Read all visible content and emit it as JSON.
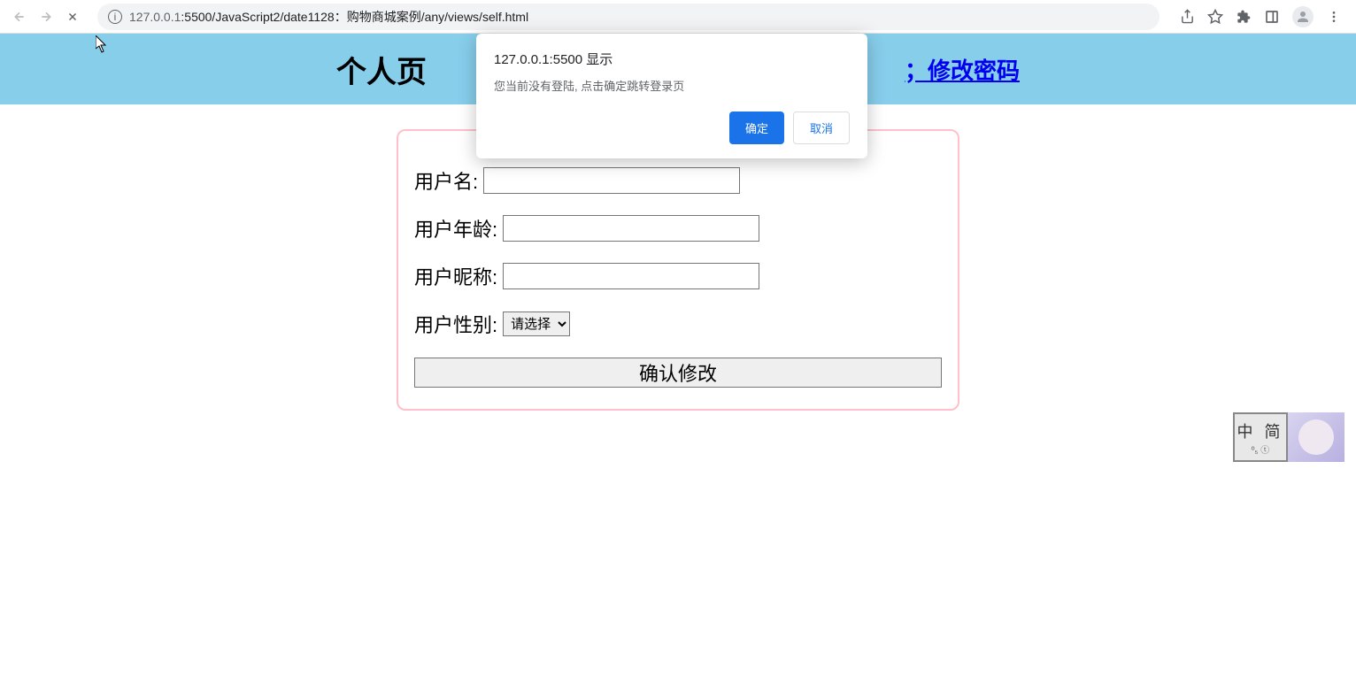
{
  "browser": {
    "url_host": "127.0.0.1",
    "url_port_path": ":5500/JavaScript2/date1128：购物商城案例/any/views/self.html"
  },
  "header": {
    "title": "个人页",
    "link_change_password": "；修改密码",
    "link_prefix": "；"
  },
  "form": {
    "username_label": "用户名:",
    "age_label": "用户年龄:",
    "nickname_label": "用户昵称:",
    "gender_label": "用户性别:",
    "gender_placeholder": "请选择",
    "submit_label": "确认修改"
  },
  "alert": {
    "title": "127.0.0.1:5500 显示",
    "message": "您当前没有登陆, 点击确定跳转登录页",
    "ok": "确定",
    "cancel": "取消"
  },
  "ime": {
    "text": "中 简",
    "sub": "º₅ ⓣ"
  }
}
